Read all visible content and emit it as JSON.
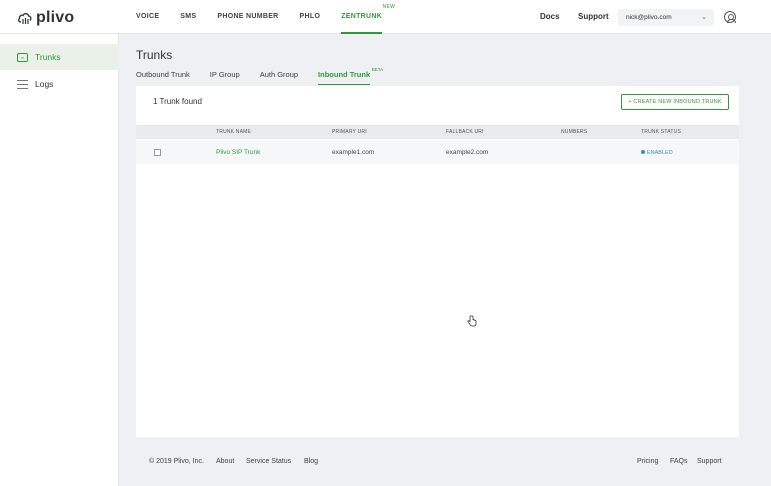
{
  "brand": {
    "name": "plivo"
  },
  "nav": {
    "items": [
      {
        "label": "VOICE"
      },
      {
        "label": "SMS"
      },
      {
        "label": "PHONE NUMBER"
      },
      {
        "label": "PHLO"
      },
      {
        "label": "ZENTRUNK",
        "badge": "NEW"
      }
    ]
  },
  "header": {
    "docs": "Docs",
    "support": "Support",
    "user_email": "nick@plivo.com"
  },
  "sidebar": {
    "items": [
      {
        "label": "Trunks",
        "icon": "trunk-icon"
      },
      {
        "label": "Logs",
        "icon": "list-icon"
      }
    ]
  },
  "page": {
    "title": "Trunks",
    "tabs": [
      {
        "label": "Outbound Trunk"
      },
      {
        "label": "IP Group"
      },
      {
        "label": "Auth Group"
      },
      {
        "label": "Inbound Trunk",
        "badge": "BETA"
      }
    ],
    "count_text": "1 Trunk found",
    "create_button": "+ CREATE NEW INBOUND TRUNK"
  },
  "table": {
    "columns": [
      "TRUNK NAME",
      "PRIMARY URI",
      "FALLBACK URI",
      "NUMBERS",
      "TRUNK STATUS"
    ],
    "rows": [
      {
        "name": "Plivo SIP Trunk",
        "primary_uri": "example1.com",
        "fallback_uri": "example2.com",
        "numbers": "",
        "status": "ENABLED"
      }
    ]
  },
  "footer": {
    "copyright": "© 2019 Plivo, Inc.",
    "left_links": [
      "About",
      "Service Status",
      "Blog"
    ],
    "right_links": [
      "Pricing",
      "FAQs",
      "Support"
    ]
  },
  "colors": {
    "accent": "#2f9a3a",
    "status": "#3c8fb5"
  }
}
